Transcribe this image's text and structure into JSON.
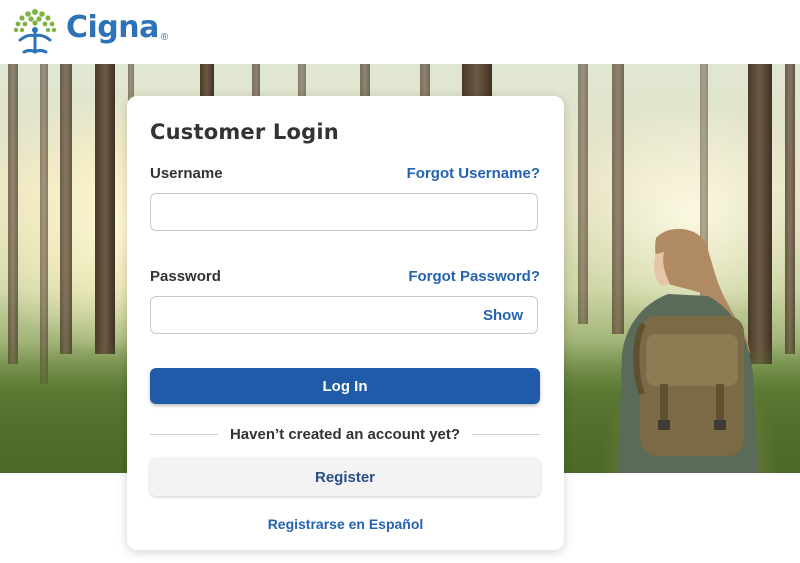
{
  "brand": {
    "name": "Cigna",
    "registered": "®",
    "logo_icon": "tree-of-life-icon",
    "colors": {
      "logo_green": "#7cb342",
      "logo_blue": "#2e73b8"
    }
  },
  "login": {
    "title": "Customer Login",
    "username_label": "Username",
    "forgot_username": "Forgot Username?",
    "username_value": "",
    "password_label": "Password",
    "forgot_password": "Forgot Password?",
    "password_value": "",
    "show_label": "Show",
    "login_button": "Log In",
    "divider_text": "Haven’t created an account yet?",
    "register_button": "Register",
    "spanish_link": "Registrarse en Español"
  },
  "colors": {
    "primary_button": "#1f5ba8",
    "link": "#2563b0",
    "register_bg": "#f3f3f3"
  }
}
